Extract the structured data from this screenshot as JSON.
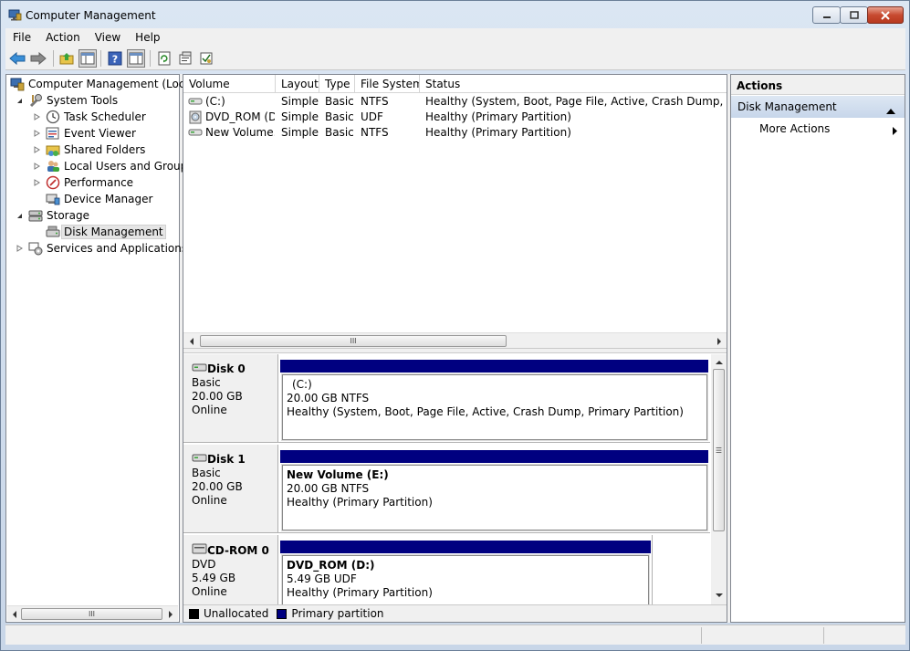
{
  "window": {
    "title": "Computer Management"
  },
  "menu": [
    "File",
    "Action",
    "View",
    "Help"
  ],
  "tree": {
    "root": "Computer Management (Local",
    "items": [
      {
        "label": "System Tools",
        "icon": "tools-icon"
      },
      {
        "label": "Task Scheduler",
        "icon": "clock-icon"
      },
      {
        "label": "Event Viewer",
        "icon": "event-viewer-icon"
      },
      {
        "label": "Shared Folders",
        "icon": "shared-folder-icon"
      },
      {
        "label": "Local Users and Groups",
        "icon": "users-icon"
      },
      {
        "label": "Performance",
        "icon": "performance-icon"
      },
      {
        "label": "Device Manager",
        "icon": "device-manager-icon"
      },
      {
        "label": "Storage",
        "icon": "storage-icon"
      },
      {
        "label": "Disk Management",
        "icon": "disk-management-icon"
      },
      {
        "label": "Services and Applications",
        "icon": "services-icon"
      }
    ]
  },
  "volumes": {
    "columns": [
      "Volume",
      "Layout",
      "Type",
      "File System",
      "Status"
    ],
    "rows": [
      {
        "volume": "(C:)",
        "layout": "Simple",
        "type": "Basic",
        "fs": "NTFS",
        "status": "Healthy (System, Boot, Page File, Active, Crash Dump, Primary"
      },
      {
        "volume": "DVD_ROM (D:)",
        "layout": "Simple",
        "type": "Basic",
        "fs": "UDF",
        "status": "Healthy (Primary Partition)"
      },
      {
        "volume": "New Volume...",
        "layout": "Simple",
        "type": "Basic",
        "fs": "NTFS",
        "status": "Healthy (Primary Partition)"
      }
    ]
  },
  "disks": [
    {
      "name": "Disk 0",
      "kind": "Basic",
      "size": "20.00 GB",
      "state": "Online",
      "partition": {
        "name": "(C:)",
        "detail": "20.00 GB NTFS",
        "status": "Healthy (System, Boot, Page File, Active, Crash Dump, Primary Partition)"
      }
    },
    {
      "name": "Disk 1",
      "kind": "Basic",
      "size": "20.00 GB",
      "state": "Online",
      "partition": {
        "name": "New Volume  (E:)",
        "detail": "20.00 GB NTFS",
        "status": "Healthy (Primary Partition)"
      }
    },
    {
      "name": "CD-ROM 0",
      "kind": "DVD",
      "size": "5.49 GB",
      "state": "Online",
      "partition": {
        "name": "DVD_ROM  (D:)",
        "detail": "5.49 GB UDF",
        "status": "Healthy (Primary Partition)"
      }
    }
  ],
  "legend": [
    {
      "label": "Unallocated",
      "color": "#000000"
    },
    {
      "label": "Primary partition",
      "color": "#000080"
    }
  ],
  "actions": {
    "header": "Actions",
    "section": "Disk Management",
    "more": "More Actions"
  },
  "scroll_glyph": "III",
  "vscroll_glyph": "☰"
}
